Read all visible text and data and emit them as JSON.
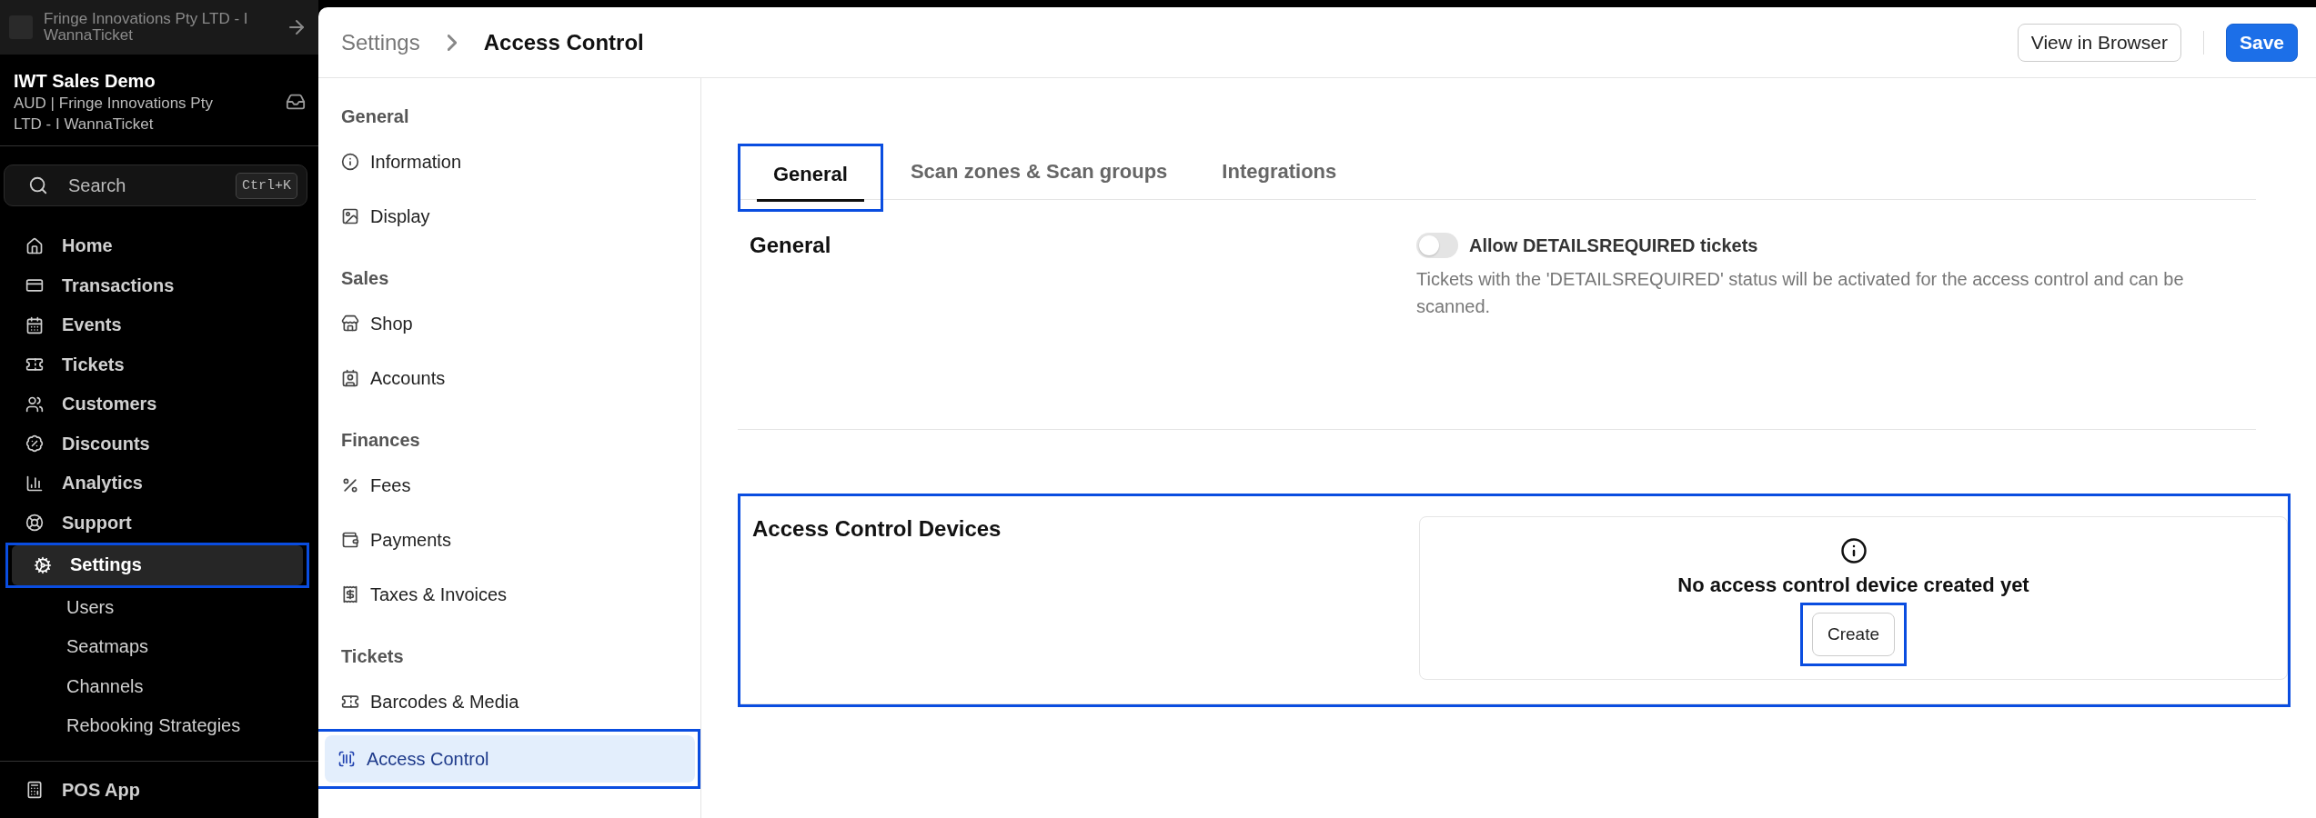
{
  "sidebar": {
    "org_name": "Fringe Innovations Pty LTD - I WannaTicket",
    "account": {
      "name": "IWT Sales Demo",
      "subtitle": "AUD | Fringe Innovations Pty LTD - I WannaTicket"
    },
    "search": {
      "placeholder": "Search",
      "shortcut": "Ctrl+K"
    },
    "items": [
      {
        "label": "Home",
        "selected": false,
        "highlighted": false
      },
      {
        "label": "Transactions",
        "selected": false,
        "highlighted": false
      },
      {
        "label": "Events",
        "selected": false,
        "highlighted": false
      },
      {
        "label": "Tickets",
        "selected": false,
        "highlighted": false
      },
      {
        "label": "Customers",
        "selected": false,
        "highlighted": false
      },
      {
        "label": "Discounts",
        "selected": false,
        "highlighted": false
      },
      {
        "label": "Analytics",
        "selected": false,
        "highlighted": false
      },
      {
        "label": "Support",
        "selected": false,
        "highlighted": false
      },
      {
        "label": "Settings",
        "selected": true,
        "highlighted": true,
        "children": [
          {
            "label": "Users",
            "selected": false
          },
          {
            "label": "Seatmaps",
            "selected": false
          },
          {
            "label": "Channels",
            "selected": false
          },
          {
            "label": "Rebooking Strategies",
            "selected": false
          }
        ]
      }
    ],
    "footer_item": {
      "label": "POS App"
    }
  },
  "breadcrumb": [
    "Settings",
    "Access Control"
  ],
  "header_buttons": [
    {
      "label": "View in Browser",
      "kind": "secondary"
    },
    {
      "label": "Save",
      "kind": "primary"
    }
  ],
  "settings_nav": [
    {
      "title": "General",
      "items": [
        {
          "label": "Information",
          "selected": false,
          "highlighted": false
        },
        {
          "label": "Display",
          "selected": false,
          "highlighted": false
        }
      ]
    },
    {
      "title": "Sales",
      "items": [
        {
          "label": "Shop",
          "selected": false,
          "highlighted": false
        },
        {
          "label": "Accounts",
          "selected": false,
          "highlighted": false
        }
      ]
    },
    {
      "title": "Finances",
      "items": [
        {
          "label": "Fees",
          "selected": false,
          "highlighted": false
        },
        {
          "label": "Payments",
          "selected": false,
          "highlighted": false
        },
        {
          "label": "Taxes & Invoices",
          "selected": false,
          "highlighted": false
        }
      ]
    },
    {
      "title": "Tickets",
      "items": [
        {
          "label": "Barcodes & Media",
          "selected": false,
          "highlighted": false
        },
        {
          "label": "Access Control",
          "selected": true,
          "highlighted": true
        }
      ]
    }
  ],
  "tabs": [
    {
      "label": "General",
      "selected": true,
      "highlighted": true
    },
    {
      "label": "Scan zones & Scan groups",
      "selected": false,
      "highlighted": false
    },
    {
      "label": "Integrations",
      "selected": false,
      "highlighted": false
    }
  ],
  "sections": [
    {
      "title": "General",
      "kind": "toggle",
      "highlighted": false,
      "toggle": {
        "label": "Allow DETAILSREQUIRED tickets",
        "on": false,
        "description": "Tickets with the 'DETAILSREQUIRED' status will be activated for the access control and can be scanned."
      }
    },
    {
      "title": "Access Control Devices",
      "kind": "empty",
      "highlighted": true,
      "empty_state": {
        "message": "No access control device created yet",
        "button": {
          "label": "Create",
          "highlighted": true
        }
      }
    }
  ]
}
